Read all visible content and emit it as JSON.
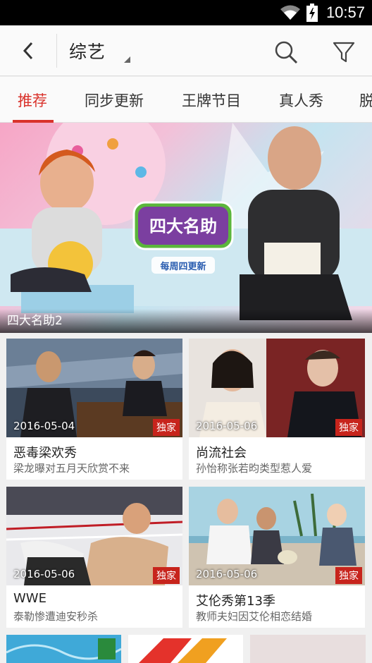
{
  "status_bar": {
    "time": "10:57",
    "icons": [
      "wifi-icon",
      "battery-charging-icon"
    ]
  },
  "header": {
    "category": "综艺",
    "icons": [
      "back-arrow-icon",
      "search-icon",
      "filter-icon"
    ]
  },
  "tabs": [
    {
      "label": "推荐",
      "active": true
    },
    {
      "label": "同步更新",
      "active": false
    },
    {
      "label": "王牌节目",
      "active": false
    },
    {
      "label": "真人秀",
      "active": false
    },
    {
      "label": "脱",
      "active": false
    }
  ],
  "banner": {
    "caption": "四大名助2",
    "logo_text": "四大名助",
    "logo_subtext": "每周四更新"
  },
  "cards": [
    {
      "date": "2016-05-04",
      "badge": "独家",
      "title": "恶毒梁欢秀",
      "subtitle": "梁龙曝对五月天欣赏不来"
    },
    {
      "date": "2016-05-06",
      "badge": "独家",
      "title": "尚流社会",
      "subtitle": "孙怡称张若昀类型惹人爱"
    },
    {
      "date": "2016-05-06",
      "badge": "独家",
      "title": "WWE",
      "subtitle": "泰勒惨遭迪安秒杀"
    },
    {
      "date": "2016-05-06",
      "badge": "独家",
      "title": "艾伦秀第13季",
      "subtitle": "教师夫妇因艾伦相恋结婚"
    }
  ],
  "colors": {
    "accent": "#d9322b",
    "badge": "#c7241c"
  }
}
